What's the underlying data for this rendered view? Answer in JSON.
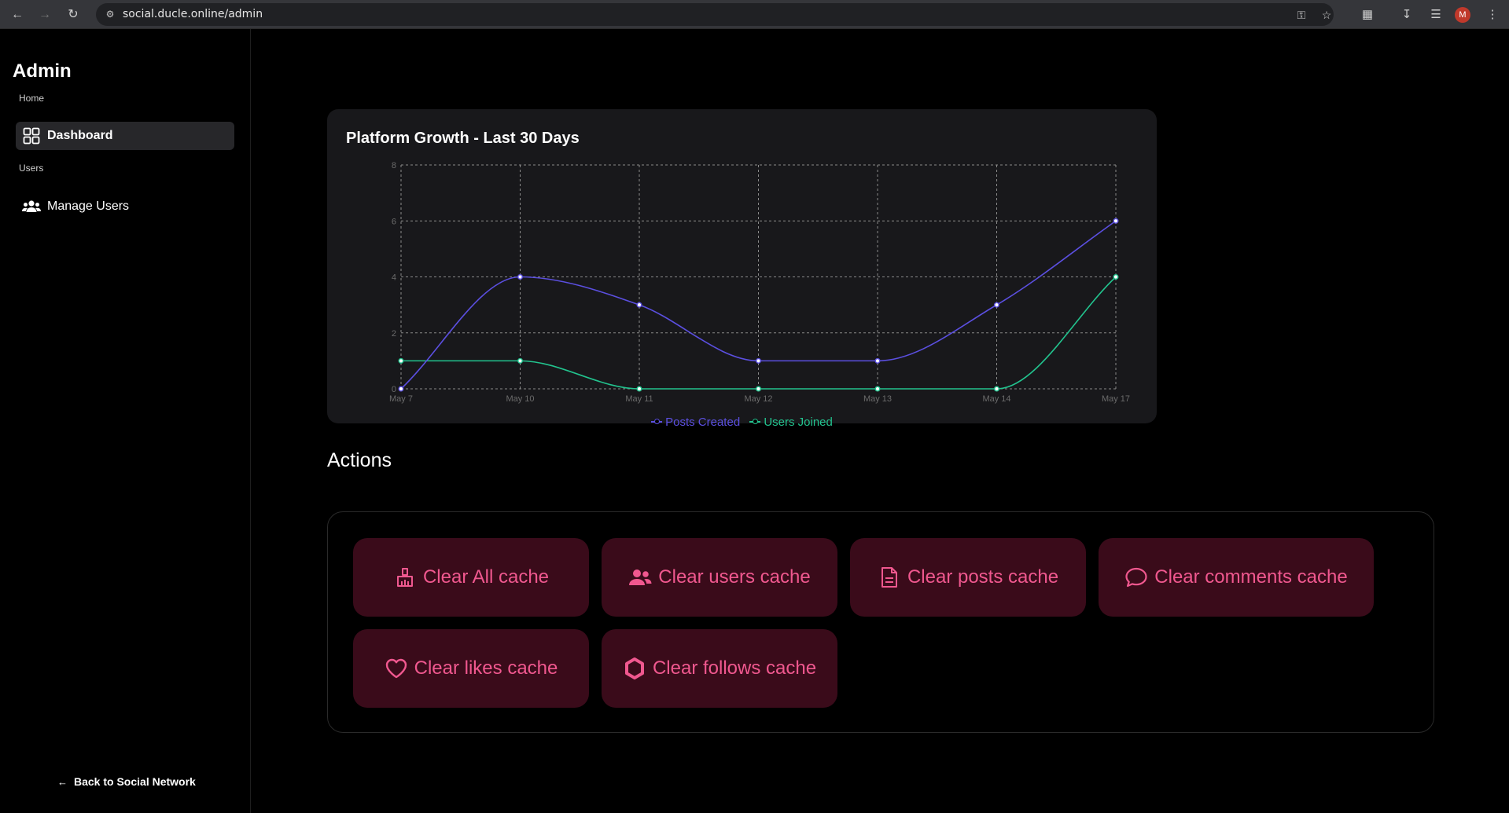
{
  "browser": {
    "url": "social.ducle.online/admin",
    "profile_initial": "M"
  },
  "sidebar": {
    "brand": "Admin",
    "groups": [
      {
        "label": "Home",
        "items": [
          {
            "label": "Dashboard",
            "icon": "dashboard-grid-icon",
            "active": true
          }
        ]
      },
      {
        "label": "Users",
        "items": [
          {
            "label": "Manage Users",
            "icon": "users-icon",
            "active": false
          }
        ]
      }
    ],
    "back_label": "Back to Social Network"
  },
  "chart": {
    "title": "Platform Growth - Last 30 Days"
  },
  "chart_data": {
    "type": "line",
    "title": "Platform Growth - Last 30 Days",
    "x": [
      "May 7",
      "May 10",
      "May 11",
      "May 12",
      "May 13",
      "May 14",
      "May 17"
    ],
    "series": [
      {
        "name": "Posts Created",
        "color": "#5b4fe0",
        "values": [
          0,
          4,
          3,
          1,
          1,
          3,
          6
        ]
      },
      {
        "name": "Users Joined",
        "color": "#22c38e",
        "values": [
          1,
          1,
          0,
          0,
          0,
          0,
          4
        ]
      }
    ],
    "ylim": [
      0,
      8
    ],
    "yticks": [
      "0",
      "2",
      "4",
      "6",
      "8"
    ],
    "grid": true,
    "legend": "bottom-center"
  },
  "actions": {
    "title": "Actions",
    "buttons": [
      {
        "label": "Clear All cache",
        "icon": "broom-icon"
      },
      {
        "label": "Clear users cache",
        "icon": "users-icon"
      },
      {
        "label": "Clear posts cache",
        "icon": "document-icon"
      },
      {
        "label": "Clear comments cache",
        "icon": "comment-icon"
      },
      {
        "label": "Clear likes cache",
        "icon": "heart-icon"
      },
      {
        "label": "Clear follows cache",
        "icon": "hexagon-icon"
      }
    ]
  },
  "colors": {
    "accent_text": "#f0588f",
    "button_bg": "#3a0b1a",
    "posts_line": "#5b4fe0",
    "users_line": "#22c38e"
  }
}
